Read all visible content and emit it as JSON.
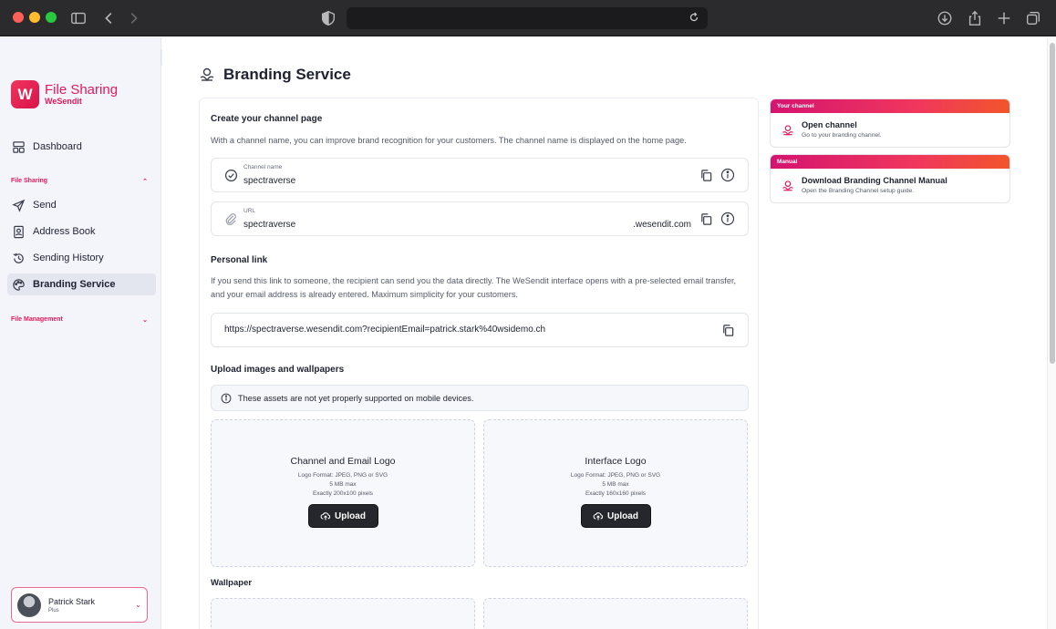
{
  "browser": {
    "url": ""
  },
  "sidebar": {
    "logo_title": "File Sharing",
    "logo_subtitle": "WeSendit",
    "logo_letter": "W",
    "dashboard": "Dashboard",
    "section_file_sharing": "File Sharing",
    "items": [
      {
        "label": "Send",
        "icon": "send-icon"
      },
      {
        "label": "Address Book",
        "icon": "address-book-icon"
      },
      {
        "label": "Sending History",
        "icon": "history-icon"
      },
      {
        "label": "Branding Service",
        "icon": "palette-icon",
        "active": true
      }
    ],
    "section_file_management": "File Management",
    "user": {
      "name": "Patrick Stark",
      "plan": "Plus"
    }
  },
  "page": {
    "title": "Branding Service",
    "channel": {
      "title": "Create your channel page",
      "description": "With a channel name, you can improve brand recognition for your customers. The channel name is displayed on the home page.",
      "name_label": "Channel name",
      "name_value": "spectraverse",
      "url_label": "URL",
      "url_value": "spectraverse",
      "url_suffix": ".wesendit.com"
    },
    "personal_link": {
      "title": "Personal link",
      "description": "If you send this link to someone, the recipient can send you the data directly. The WeSendit interface opens with a pre-selected email transfer, and your email address is already entered. Maximum simplicity for your customers.",
      "value": "https://spectraverse.wesendit.com?recipientEmail=patrick.stark%40wsidemo.ch"
    },
    "uploads": {
      "title": "Upload images and wallpapers",
      "notice": "These assets are not yet properly supported on mobile devices.",
      "boxes": [
        {
          "title": "Channel and Email Logo",
          "format": "Logo Format: JPEG, PNG or SVG",
          "size": "5 MB max",
          "dims": "Exactly 200x100 pixels",
          "button": "Upload"
        },
        {
          "title": "Interface Logo",
          "format": "Logo Format: JPEG, PNG or SVG",
          "size": "5 MB max",
          "dims": "Exactly 160x160 pixels",
          "button": "Upload"
        }
      ],
      "wallpaper_title": "Wallpaper"
    }
  },
  "right_cards": [
    {
      "header": "Your channel",
      "title": "Open channel",
      "desc": "Go to your branding channel."
    },
    {
      "header": "Manual",
      "title": "Download Branding Channel Manual",
      "desc": "Open the Branding Channel setup guide."
    }
  ],
  "colors": {
    "brand": "#e2195a",
    "sidebar_bg": "#f4f5fb",
    "button_dark": "#26272d"
  }
}
